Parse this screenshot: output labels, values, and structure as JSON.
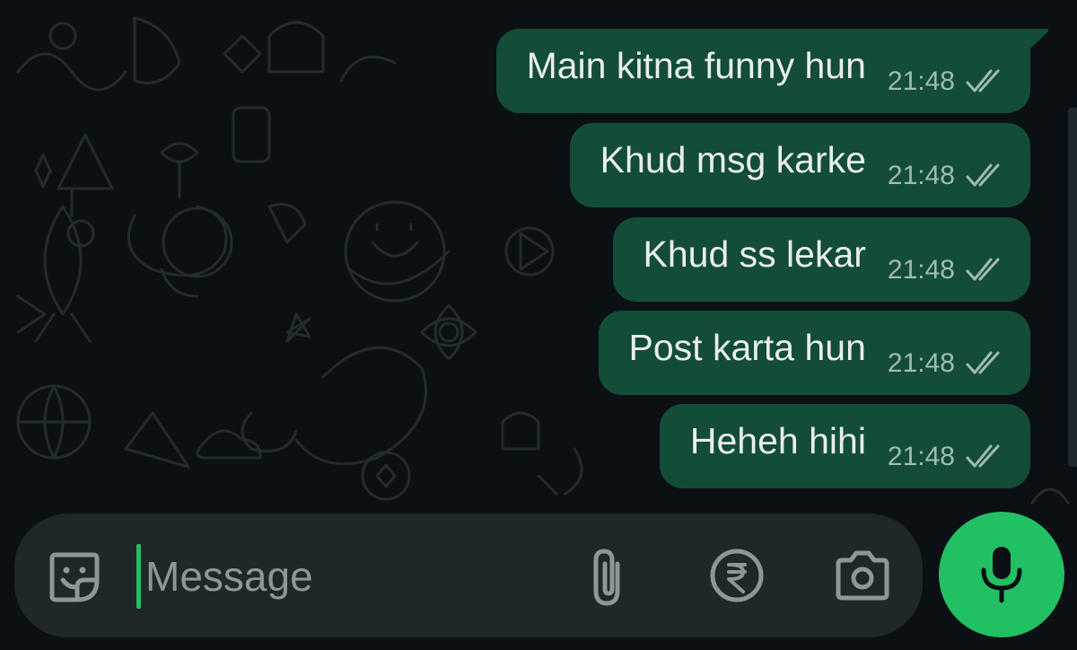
{
  "chat": {
    "messages": [
      {
        "text": "Main kitna funny hun",
        "time": "21:48",
        "status": "read"
      },
      {
        "text": "Khud msg karke",
        "time": "21:48",
        "status": "read"
      },
      {
        "text": "Khud ss lekar",
        "time": "21:48",
        "status": "read"
      },
      {
        "text": "Post karta hun",
        "time": "21:48",
        "status": "read"
      },
      {
        "text": "Heheh hihi",
        "time": "21:48",
        "status": "read"
      }
    ]
  },
  "composer": {
    "placeholder": "Message",
    "value": "",
    "icons": {
      "sticker": "sticker-icon",
      "attach": "paperclip-icon",
      "payment": "rupee-icon",
      "camera": "camera-icon",
      "mic": "microphone-icon"
    }
  },
  "colors": {
    "background": "#0b1014",
    "bubble_outgoing": "#134d37",
    "composer_bg": "#1f272a",
    "accent": "#21c063",
    "text": "#e9edef",
    "meta_text": "#9fbcaf"
  }
}
